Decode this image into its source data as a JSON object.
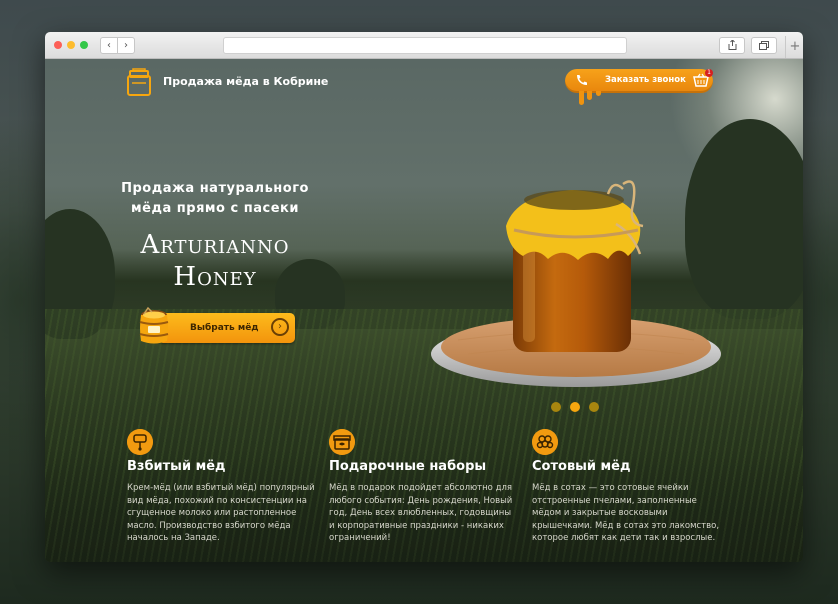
{
  "site": {
    "brand": "Продажа мёда в Кобрине",
    "call_label": "Заказать звонок",
    "cart_count": "1"
  },
  "hero": {
    "tagline_line1": "Продажа натурального",
    "tagline_line2": "мёда прямо с пасеки",
    "title_line1": "Arturianno",
    "title_line2": "Honey",
    "cta_label": "Выбрать мёд"
  },
  "slider": {
    "count": 3,
    "active_index": 1
  },
  "features": [
    {
      "title": "Взбитый мёд",
      "text": "Крем-мёд (или взбитый мёд) популярный вид мёда, похожий по консистенции на сгущенное молоко или растопленное масло. Производство взбитого мёда началось на Западе.",
      "icon": "whisk-icon"
    },
    {
      "title": "Подарочные наборы",
      "text": "Мёд в подарок подойдет абсолютно для любого события: День рождения, Новый год, День всех влюбленных, годовщины и корпоративные праздники - никаких ограничений!",
      "icon": "gift-box-icon"
    },
    {
      "title": "Сотовый мёд",
      "text": "Мёд в сотах — это сотовые ячейки отстроенные пчелами, заполненные мёдом и закрытые восковыми крышечками. Мёд в сотах это лакомство, которое любят как дети так и взрослые.",
      "icon": "honeycomb-icon"
    }
  ],
  "colors": {
    "accent": "#f6a60f",
    "accent_dark": "#e8850c",
    "text_light": "#ffffff",
    "text_muted": "#d7d7cc"
  }
}
